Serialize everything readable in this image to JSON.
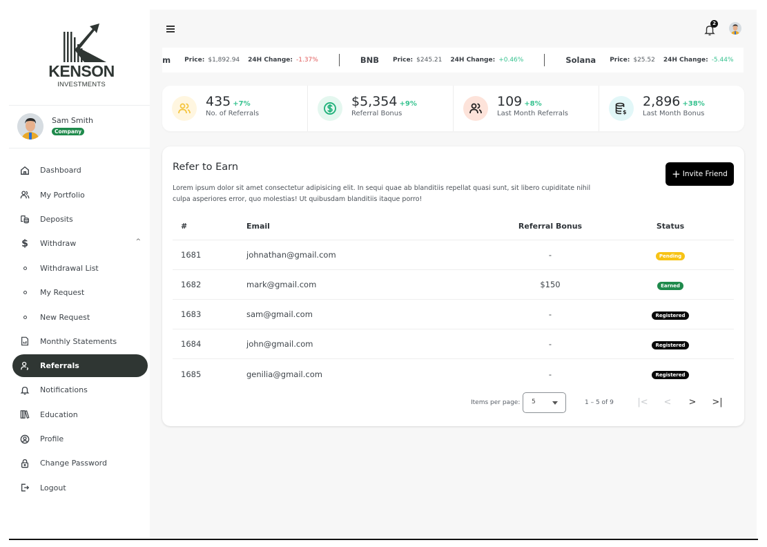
{
  "brand": {
    "name": "KENSON",
    "tagline": "INVESTMENTS"
  },
  "user": {
    "name": "Sam Smith",
    "role_badge": "Company"
  },
  "sidebar": {
    "items": [
      {
        "label": "Dashboard",
        "icon": "home-icon"
      },
      {
        "label": "My Portfolio",
        "icon": "users-icon"
      },
      {
        "label": "Deposits",
        "icon": "coins-icon"
      },
      {
        "label": "Withdraw",
        "icon": "dollar-icon",
        "expanded": true
      },
      {
        "label": "Withdrawal List",
        "icon": "circle-icon",
        "sub": true
      },
      {
        "label": "My Request",
        "icon": "circle-icon",
        "sub": true
      },
      {
        "label": "New Request",
        "icon": "circle-icon",
        "sub": true
      },
      {
        "label": "Monthly Statements",
        "icon": "statement-icon"
      },
      {
        "label": "Referrals",
        "icon": "user-referral-icon",
        "active": true
      },
      {
        "label": "Notifications",
        "icon": "bell-icon"
      },
      {
        "label": "Education",
        "icon": "books-icon"
      },
      {
        "label": "Profile",
        "icon": "user-circle-icon"
      },
      {
        "label": "Change Password",
        "icon": "lock-icon"
      },
      {
        "label": "Logout",
        "icon": "logout-icon"
      }
    ],
    "withdraw_caret": "^"
  },
  "header": {
    "notification_count": "2"
  },
  "ticker": {
    "price_label": "Price:",
    "change_label": "24H Change:",
    "items": [
      {
        "name": "Ethereum",
        "visible_name": "um",
        "price": "$1,892.94",
        "change": "-1.37%",
        "change_color": "#e05a5a"
      },
      {
        "name": "BNB",
        "visible_name": "BNB",
        "price": "$245.21",
        "change": "+0.46%",
        "change_color": "#36c28f"
      },
      {
        "name": "Solana",
        "visible_name": "Solana",
        "price": "$25.52",
        "change": "-5.44%",
        "change_color": "#36c28f"
      }
    ]
  },
  "stats": [
    {
      "value": "435",
      "change": "+7%",
      "label": "No. of Referrals",
      "icon": "users-icon",
      "icon_bg": "#fff6e0",
      "icon_color": "#f4c43b"
    },
    {
      "value": "$5,354",
      "change": "+9%",
      "label": "Referral Bonus",
      "icon": "dollar-circle-icon",
      "icon_bg": "#e4f7ef",
      "icon_color": "#23b27c"
    },
    {
      "value": "109",
      "change": "+8%",
      "label": "Last Month Referrals",
      "icon": "users-icon",
      "icon_bg": "#fde3da",
      "icon_color": "#222222"
    },
    {
      "value": "2,896",
      "change": "+38%",
      "label": "Last Month Bonus",
      "icon": "database-dollar-icon",
      "icon_bg": "#e2f7f8",
      "icon_color": "#222222"
    }
  ],
  "referral": {
    "title": "Refer to Earn",
    "description": "Lorem ipsum dolor sit amet consectetur adipisicing elit. In sequi quae ab blanditiis repellat quasi sunt, sit libero cupiditate nihil culpa asperiores error, quo molestias! Ut quibusdam blanditiis itaque porro!",
    "invite_label": "Invite Friend",
    "columns": [
      "#",
      "Email",
      "Referral Bonus",
      "Status"
    ],
    "rows": [
      {
        "id": "1681",
        "email": "johnathan@gmail.com",
        "bonus": "-",
        "status": "Pending"
      },
      {
        "id": "1682",
        "email": "mark@gmail.com",
        "bonus": "$150",
        "status": "Earned"
      },
      {
        "id": "1683",
        "email": "sam@gmail.com",
        "bonus": "-",
        "status": "Registered"
      },
      {
        "id": "1684",
        "email": "john@gmail.com",
        "bonus": "-",
        "status": "Registered"
      },
      {
        "id": "1685",
        "email": "genilia@gmail.com",
        "bonus": "-",
        "status": "Registered"
      }
    ],
    "status_colors": {
      "Pending": "#f7c315",
      "Earned": "#1f8a4c",
      "Registered": "#0a0a0a"
    }
  },
  "pagination": {
    "items_per_page_label": "Items per page:",
    "items_per_page": "5",
    "range": "1 – 5 of 9",
    "first_label": "|<",
    "prev_label": "<",
    "next_label": ">",
    "last_label": ">|"
  }
}
